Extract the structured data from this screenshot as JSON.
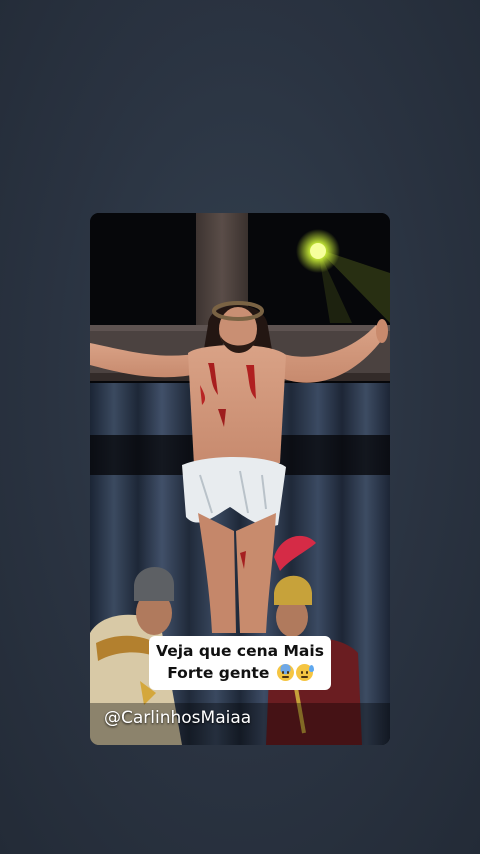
{
  "video": {
    "caption_line1": "Veja que cena Mais",
    "caption_line2": "Forte gente",
    "caption_emojis": [
      "anxious-face-with-sweat",
      "downcast-face-with-sweat"
    ],
    "watermark": "@CarlinhosMaiaa"
  },
  "colors": {
    "background": "#2b3442",
    "caption_background": "#ffffff",
    "caption_text": "#111111",
    "watermark_text": "#ffffff",
    "spotlight": "#d8ff3a"
  }
}
